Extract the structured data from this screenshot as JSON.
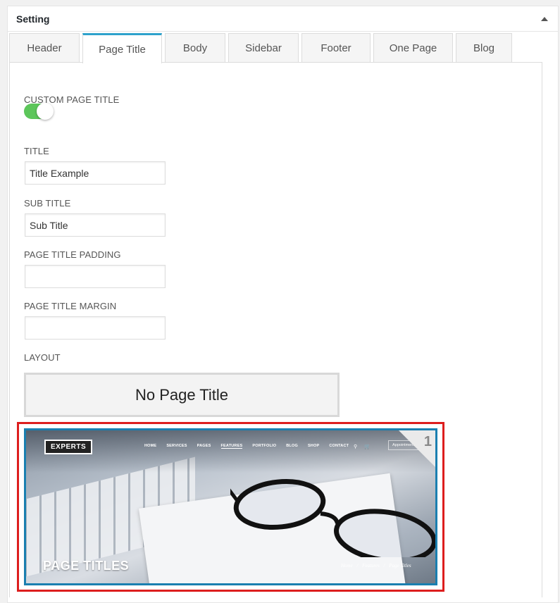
{
  "panel": {
    "title": "Setting"
  },
  "tabs": [
    {
      "label": "Header"
    },
    {
      "label": "Page Title"
    },
    {
      "label": "Body"
    },
    {
      "label": "Sidebar"
    },
    {
      "label": "Footer"
    },
    {
      "label": "One Page"
    },
    {
      "label": "Blog"
    }
  ],
  "active_tab": "Page Title",
  "form": {
    "custom_page_title_label": "CUSTOM PAGE TITLE",
    "custom_page_title_on": true,
    "title_label": "TITLE",
    "title_value": "Title Example",
    "sub_title_label": "SUB TITLE",
    "sub_title_value": "Sub Title",
    "padding_label": "PAGE TITLE PADDING",
    "padding_value": "",
    "margin_label": "PAGE TITLE MARGIN",
    "margin_value": "",
    "layout_label": "LAYOUT"
  },
  "layout_options": {
    "none_label": "No Page Title",
    "option1": {
      "number": "1",
      "logo": "EXPERTS",
      "nav": [
        "HOME",
        "SERVICES",
        "PAGES",
        "FEATURES",
        "PORTFOLIO",
        "BLOG",
        "SHOP",
        "CONTACT"
      ],
      "nav_current": "FEATURES",
      "appointment": "Appointment",
      "heading": "PAGE TITLES",
      "breadcrumb": [
        "Home",
        "/",
        "Features",
        "/",
        "Page Titles"
      ]
    }
  },
  "colors": {
    "accent": "#2ea2cc",
    "toggle_on": "#5cc65a",
    "selected_border": "#dd1e1e",
    "preview_border": "#1a7fb0"
  }
}
